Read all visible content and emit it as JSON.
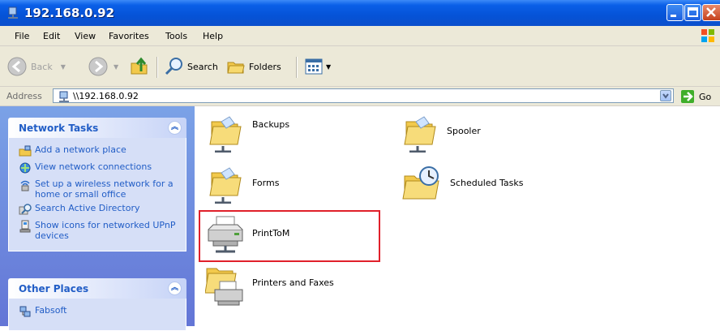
{
  "window": {
    "title": "192.168.0.92"
  },
  "menu": [
    "File",
    "Edit",
    "View",
    "Favorites",
    "Tools",
    "Help"
  ],
  "toolbar": {
    "back_label": "Back",
    "search_label": "Search",
    "folders_label": "Folders"
  },
  "address": {
    "label": "Address",
    "value": "\\\\192.168.0.92",
    "go_label": "Go"
  },
  "sidebar": {
    "network_tasks": {
      "title": "Network Tasks",
      "items": [
        {
          "label": "Add a network place",
          "icon": "add-network-place-icon"
        },
        {
          "label": "View network connections",
          "icon": "network-connections-icon"
        },
        {
          "label": "Set up a wireless network for a home or small office",
          "icon": "wireless-icon"
        },
        {
          "label": "Search Active Directory",
          "icon": "search-directory-icon"
        },
        {
          "label": "Show icons for networked UPnP devices",
          "icon": "upnp-icon"
        }
      ]
    },
    "other_places": {
      "title": "Other Places",
      "items": [
        {
          "label": "Fabsoft",
          "icon": "network-computer-icon"
        }
      ]
    }
  },
  "content": {
    "items": [
      {
        "label": "Backups",
        "icon": "shared-folder-icon"
      },
      {
        "label": "Spooler",
        "icon": "shared-folder-icon"
      },
      {
        "label": "Forms",
        "icon": "shared-folder-icon"
      },
      {
        "label": "Scheduled Tasks",
        "icon": "scheduled-tasks-folder-icon"
      },
      {
        "label": "PrintToM",
        "icon": "shared-printer-icon",
        "highlighted": true
      },
      {
        "label": "Printers and Faxes",
        "icon": "printers-faxes-folder-icon"
      }
    ]
  },
  "colors": {
    "titlebar": "#0553d7",
    "sidebar_bg": "#6375d6",
    "task_link": "#215dc6",
    "highlight_box": "#e0202a"
  }
}
